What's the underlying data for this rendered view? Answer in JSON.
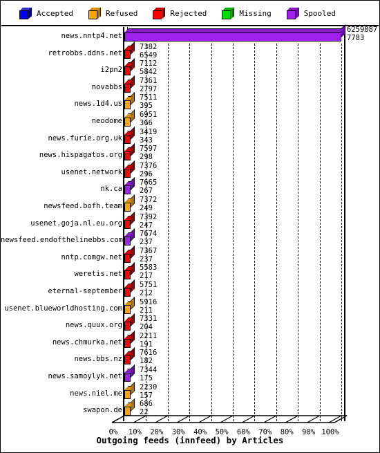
{
  "legend": {
    "items": [
      {
        "label": "Accepted",
        "color": "#0000ff",
        "side": "#000099",
        "top": "#3333cc"
      },
      {
        "label": "Refused",
        "color": "#ffa500",
        "side": "#b37300",
        "top": "#d99100"
      },
      {
        "label": "Rejected",
        "color": "#ff0000",
        "side": "#990000",
        "top": "#cc0000"
      },
      {
        "label": "Missing",
        "color": "#00e000",
        "side": "#008f00",
        "top": "#00b800"
      },
      {
        "label": "Spooled",
        "color": "#a020f0",
        "side": "#6a0dad",
        "top": "#8b18c9"
      }
    ]
  },
  "axis": {
    "title": "Outgoing feeds (innfeed) by Articles",
    "ticks": [
      "0%",
      "10%",
      "20%",
      "30%",
      "40%",
      "50%",
      "60%",
      "70%",
      "80%",
      "90%",
      "100%"
    ]
  },
  "chart_data": {
    "type": "bar",
    "orientation": "horizontal",
    "title": "Outgoing feeds (innfeed) by Articles",
    "xlabel": "Outgoing feeds (innfeed) by Articles",
    "ylabel": "",
    "xlim": [
      0,
      100
    ],
    "xunit": "%",
    "grid": true,
    "legend_position": "top",
    "note": "Each category shows two stacked numeric annotations: the upper number is the articles total and the lower number is the secondary count. Bar length encodes percent of the largest value.",
    "categories": [
      "news.nntp4.net",
      "retrobbs.ddns.net",
      "i2pn2",
      "novabbs",
      "news.1d4.us",
      "neodome",
      "news.furie.org.uk",
      "news.hispagatos.org",
      "usenet.network",
      "nk.ca",
      "newsfeed.bofh.team",
      "usenet.goja.nl.eu.org",
      "newsfeed.endofthelinebbs.com",
      "nntp.comgw.net",
      "weretis.net",
      "eternal-september",
      "usenet.blueworldhosting.com",
      "news.quux.org",
      "news.chmurka.net",
      "news.bbs.nz",
      "news.samoylyk.net",
      "news.niel.me",
      "swapon.de"
    ],
    "values_upper": [
      6259087,
      7382,
      7112,
      7361,
      7511,
      6951,
      3419,
      7597,
      7376,
      7665,
      7372,
      7392,
      7674,
      7367,
      5583,
      5751,
      5916,
      7331,
      2211,
      7616,
      7344,
      2230,
      686
    ],
    "values_lower": [
      7783,
      6549,
      5842,
      2797,
      395,
      366,
      343,
      298,
      296,
      267,
      249,
      247,
      237,
      237,
      217,
      212,
      211,
      204,
      191,
      182,
      175,
      157,
      22
    ],
    "percents": [
      100.0,
      0.118,
      0.093,
      0.045,
      0.0063,
      0.0058,
      0.0055,
      0.0048,
      0.0047,
      0.0043,
      0.004,
      0.0039,
      0.0038,
      0.0038,
      0.0035,
      0.0034,
      0.0034,
      0.0033,
      0.0031,
      0.0029,
      0.0028,
      0.0025,
      0.0004
    ],
    "series": [
      {
        "name": "Accepted",
        "color": "#0000ff"
      },
      {
        "name": "Refused",
        "color": "#ffa500"
      },
      {
        "name": "Rejected",
        "color": "#ff0000"
      },
      {
        "name": "Missing",
        "color": "#00e000"
      },
      {
        "name": "Spooled",
        "color": "#a020f0"
      }
    ],
    "bar_series": [
      "Spooled",
      "Rejected",
      "Rejected",
      "Rejected",
      "Refused",
      "Refused",
      "Rejected",
      "Rejected",
      "Rejected",
      "Spooled",
      "Refused",
      "Rejected",
      "Spooled",
      "Rejected",
      "Rejected",
      "Rejected",
      "Refused",
      "Rejected",
      "Rejected",
      "Rejected",
      "Spooled",
      "Refused",
      "Refused"
    ]
  }
}
